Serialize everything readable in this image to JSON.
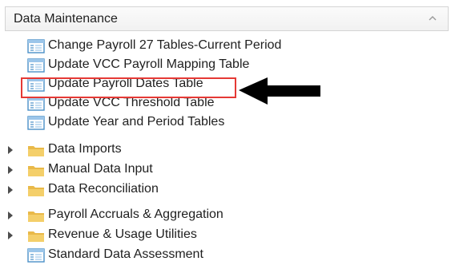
{
  "panel": {
    "title": "Data Maintenance"
  },
  "tree": {
    "items": [
      {
        "label": "Change Payroll 27 Tables-Current Period",
        "icon": "table-form-icon",
        "expandable": false
      },
      {
        "label": "Update VCC Payroll Mapping Table",
        "icon": "table-form-icon",
        "expandable": false
      },
      {
        "label": "Update Payroll Dates Table",
        "icon": "table-form-icon",
        "expandable": false,
        "highlighted": true
      },
      {
        "label": "Update VCC Threshold Table",
        "icon": "table-form-icon",
        "expandable": false
      },
      {
        "label": "Update Year and Period Tables",
        "icon": "table-form-icon",
        "expandable": false
      },
      {
        "label": "Data Imports",
        "icon": "folder-icon",
        "expandable": true
      },
      {
        "label": "Manual Data Input",
        "icon": "folder-icon",
        "expandable": true
      },
      {
        "label": "Data Reconciliation",
        "icon": "folder-icon",
        "expandable": true
      },
      {
        "label": "Payroll Accruals &  Aggregation",
        "icon": "folder-icon",
        "expandable": true
      },
      {
        "label": "Revenue & Usage Utilities",
        "icon": "folder-icon",
        "expandable": true
      },
      {
        "label": "Standard Data Assessment",
        "icon": "table-form-icon",
        "expandable": false
      }
    ]
  },
  "colors": {
    "highlight_border": "#e53935",
    "folder": "#e9b949",
    "form_icon": "#4a90c8",
    "pointer_arrow": "#000000"
  }
}
